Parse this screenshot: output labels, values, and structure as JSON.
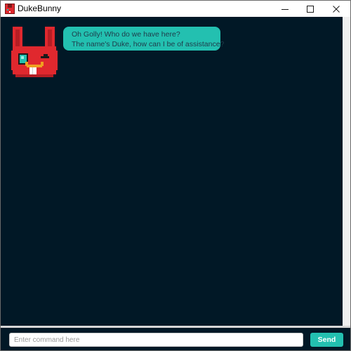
{
  "window": {
    "title": "DukeBunny",
    "icon": "bunny-app-icon",
    "controls": {
      "minimize_icon": "minimize-icon",
      "maximize_icon": "maximize-icon",
      "close_icon": "close-icon"
    }
  },
  "chat": {
    "messages": [
      {
        "sender": "bot",
        "avatar_icon": "duke-bunny-avatar",
        "lines": [
          "Oh Golly! Who do we have here?",
          "The name's Duke, how can I be of assistance?"
        ]
      }
    ]
  },
  "input_bar": {
    "placeholder": "Enter command here",
    "value": "",
    "send_label": "Send"
  },
  "colors": {
    "chat_background": "#011826",
    "accent": "#23c0b0",
    "bubble_text": "#1f3b4a",
    "bunny_red": "#e0282e"
  }
}
